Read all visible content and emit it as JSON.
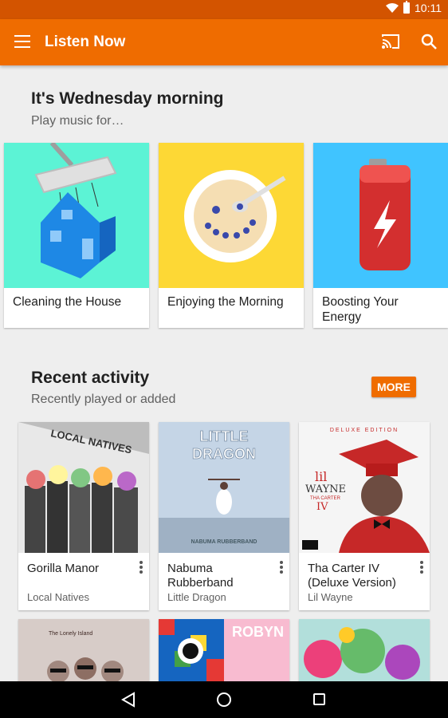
{
  "status": {
    "time": "10:11"
  },
  "appbar": {
    "title": "Listen Now",
    "menu_icon": "hamburger-menu-icon",
    "cast_icon": "cast-icon",
    "search_icon": "search-icon"
  },
  "greeting": {
    "title": "It's Wednesday morning",
    "subtitle": "Play music for…",
    "cards": [
      {
        "label": "Cleaning the House",
        "color": "#5cf3d5"
      },
      {
        "label": "Enjoying the Morning",
        "color": "#fdd835"
      },
      {
        "label": "Boosting Your Energy",
        "color": "#40c4ff"
      }
    ]
  },
  "recent": {
    "title": "Recent activity",
    "subtitle": "Recently played or added",
    "more_label": "MORE",
    "albums": [
      {
        "name": "Gorilla Manor",
        "artist": "Local Natives",
        "cover_text": "LOCAL NATIVES"
      },
      {
        "name": "Nabuma Rubberband",
        "artist": "Little Dragon",
        "cover_title": "LITTLE DRAGON",
        "cover_sub": "NABUMA RUBBERBAND"
      },
      {
        "name": "Tha Carter IV (Deluxe Version)",
        "artist": "Lil Wayne",
        "cover_top": "DELUXE EDITION",
        "cover_l1": "lil",
        "cover_l2": "WAYNE",
        "cover_l3": "THA CARTER",
        "cover_l4": "IV"
      }
    ],
    "next_row": [
      {
        "cover_text": "The Lonely Island"
      },
      {
        "cover_text": "ROBYN"
      },
      {
        "cover_text": ""
      }
    ]
  },
  "colors": {
    "appbar": "#ef6c00",
    "statusbar": "#d35400",
    "accent": "#ef6c00"
  }
}
